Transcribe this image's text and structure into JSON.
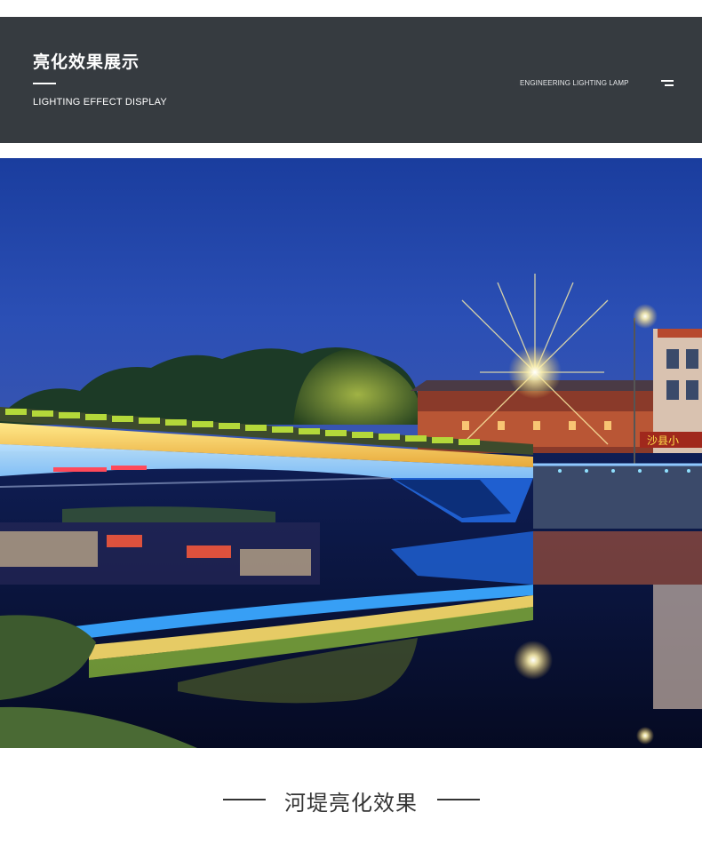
{
  "header": {
    "title": "亮化效果展示",
    "subtitle": "LIGHTING EFFECT DISPLAY",
    "right_label": "ENGINEERING LIGHTING LAMP"
  },
  "photo": {
    "subject": "illuminated-bridge-night",
    "sign_text": "沙县小"
  },
  "caption": {
    "text": "河堤亮化效果"
  },
  "colors": {
    "banner_bg": "#363b40",
    "bridge_light": "#3aa6ff",
    "rail_light": "#ffd84a",
    "sky": "#1e3ea0"
  },
  "icons": [
    "menu-icon"
  ]
}
